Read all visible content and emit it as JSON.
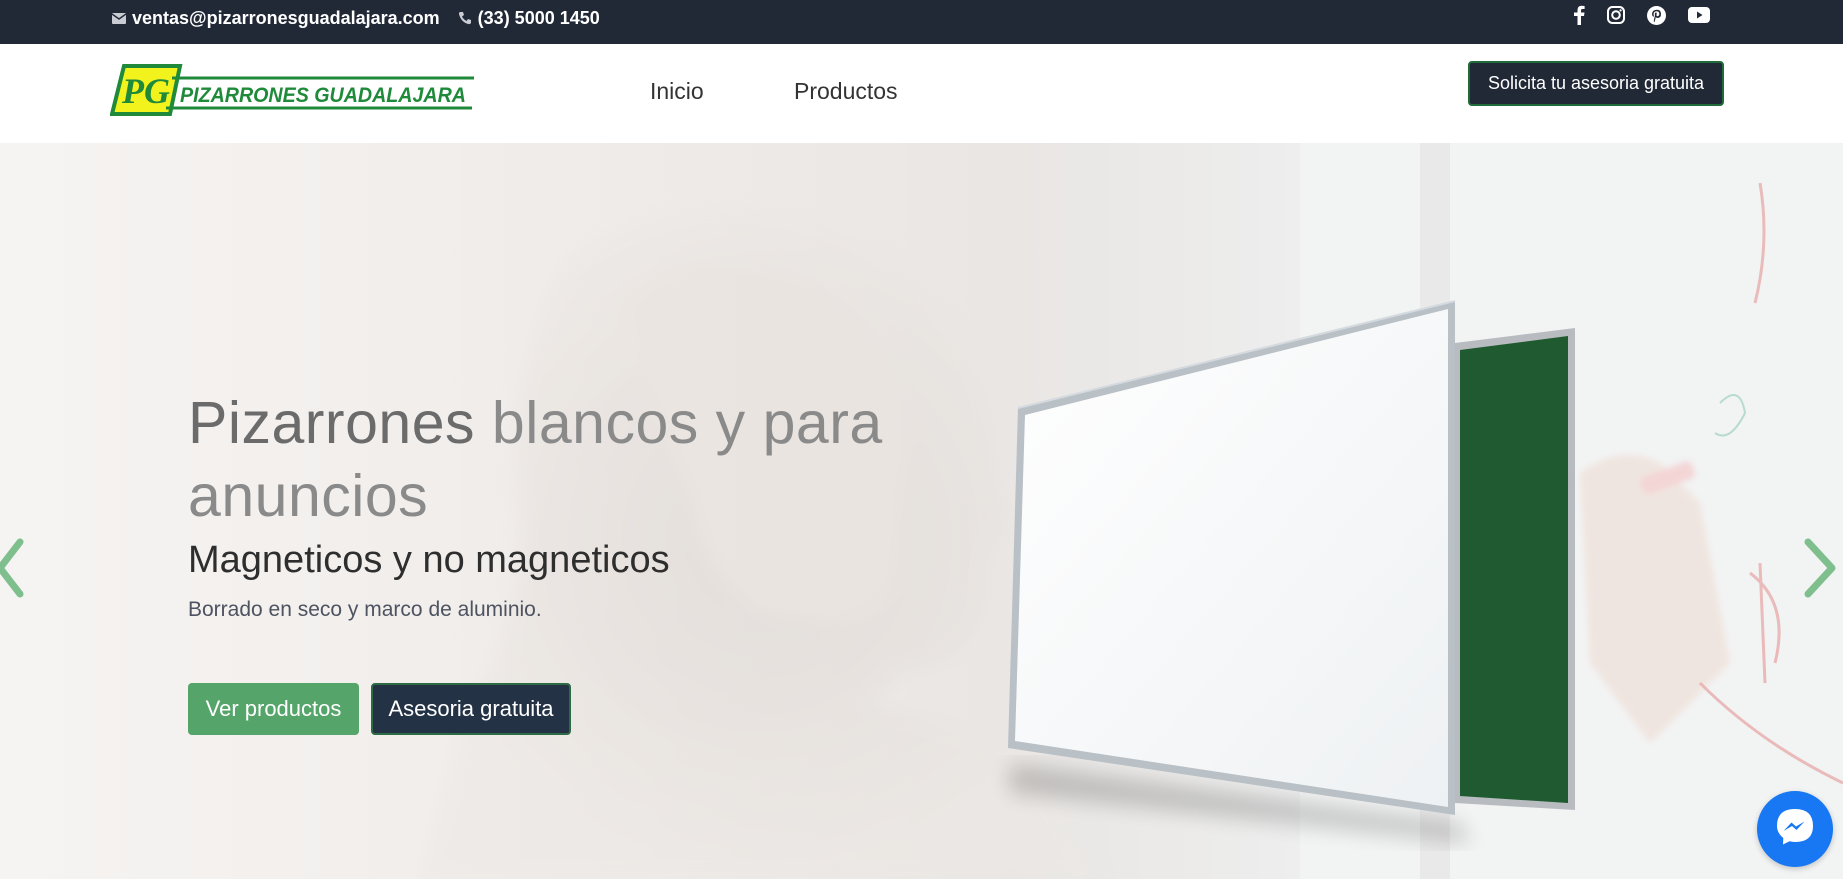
{
  "topbar": {
    "email": "ventas@pizarronesguadalajara.com",
    "phone": "(33) 5000 1450",
    "icons": [
      "envelope-icon",
      "phone-icon",
      "facebook-icon",
      "instagram-icon",
      "pinterest-icon",
      "youtube-icon"
    ]
  },
  "header": {
    "logo_mark": "PG",
    "logo_text": "PIZARRONES GUADALAJARA",
    "nav": [
      "Inicio",
      "Productos"
    ],
    "cta": "Solicita tu asesoria gratuita"
  },
  "hero": {
    "title_strong": "Pizarrones",
    "title_light_1": "blancos y para",
    "title_light_2": "anuncios",
    "subtitle": "Magneticos y no magneticos",
    "description": "Borrado en seco y marco de aluminio.",
    "primary_button": "Ver productos",
    "secondary_button": "Asesoria gratuita"
  },
  "colors": {
    "topbar_bg": "#212936",
    "brand_green": "#1f8a3a",
    "brand_yellow": "#f2f21c",
    "button_green": "#55a56a",
    "button_dark": "#243245",
    "messenger_blue": "#1877f2"
  }
}
